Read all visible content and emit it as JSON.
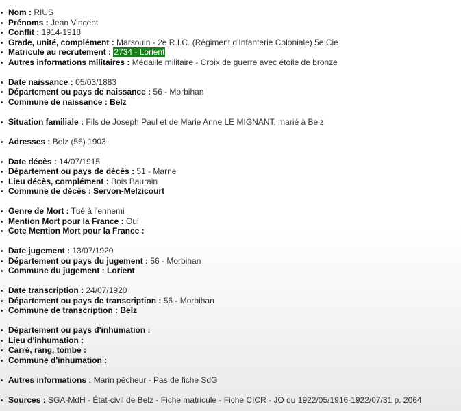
{
  "groups": [
    {
      "rows": [
        {
          "label": "Nom :",
          "value": "RIUS"
        },
        {
          "label": "Prénoms :",
          "value": "Jean Vincent"
        },
        {
          "label": "Conflit :",
          "value": "1914-1918"
        },
        {
          "label": "Grade, unité, complément :",
          "value": "Marsouin - 2e R.I.C. (Régiment d'Infanterie Coloniale) 5e Cie"
        },
        {
          "label": "Matricule au recrutement :",
          "value": "2734 - Lorient",
          "highlight": true
        },
        {
          "label": "Autres informations militaires :",
          "value": "Médaille militaire - Croix de guerre avec étoile de bronze"
        }
      ]
    },
    {
      "rows": [
        {
          "label": "Date naissance :",
          "value": "05/03/1883"
        },
        {
          "label": "Département ou pays de naissance :",
          "value": "56 - Morbihan"
        },
        {
          "label": "Commune de naissance :",
          "value": "Belz",
          "bold": true
        }
      ]
    },
    {
      "rows": [
        {
          "label": "Situation familiale :",
          "value": "Fils de Joseph Paul et de Marie Anne LE MIGNANT, marié à Belz"
        }
      ]
    },
    {
      "rows": [
        {
          "label": "Adresses :",
          "value": "Belz (56) 1903"
        }
      ]
    },
    {
      "rows": [
        {
          "label": "Date décès :",
          "value": "14/07/1915"
        },
        {
          "label": "Département ou pays de décès :",
          "value": "51 - Marne"
        },
        {
          "label": "Lieu décès, complément :",
          "value": "Bois Baurain"
        },
        {
          "label": "Commune de décès :",
          "value": "Servon-Melzicourt",
          "bold": true
        }
      ]
    },
    {
      "rows": [
        {
          "label": "Genre de Mort :",
          "value": "Tué à l'ennemi"
        },
        {
          "label": "Mention Mort pour la France :",
          "value": "Oui"
        },
        {
          "label": "Cote Mention Mort pour la France :",
          "value": ""
        }
      ]
    },
    {
      "rows": [
        {
          "label": "Date jugement :",
          "value": "13/07/1920"
        },
        {
          "label": "Département ou pays du jugement :",
          "value": "56 - Morbihan"
        },
        {
          "label": "Commune du jugement :",
          "value": "Lorient",
          "bold": true
        }
      ]
    },
    {
      "rows": [
        {
          "label": "Date transcription :",
          "value": "24/07/1920"
        },
        {
          "label": "Département ou pays de transcription :",
          "value": "56 - Morbihan"
        },
        {
          "label": "Commune de transcription :",
          "value": "Belz",
          "bold": true
        }
      ]
    },
    {
      "rows": [
        {
          "label": "Département ou pays d'inhumation :",
          "value": ""
        },
        {
          "label": "Lieu d'inhumation :",
          "value": ""
        },
        {
          "label": "Carré, rang, tombe :",
          "value": ""
        },
        {
          "label": "Commune d'inhumation :",
          "value": ""
        }
      ]
    },
    {
      "rows": [
        {
          "label": "Autres informations :",
          "value": "Marin pêcheur - Pas de fiche SdG"
        }
      ]
    },
    {
      "rows": [
        {
          "label": "Sources :",
          "value": "SGA-MdH - État-civil de Belz - Fiche matricule - Fiche CICR - JO du 1922/05/1916-1922/07/31 p. 2064"
        }
      ]
    }
  ],
  "colors": {
    "highlight_bg": "#1a7f1a",
    "highlight_text": "#ffffff"
  }
}
